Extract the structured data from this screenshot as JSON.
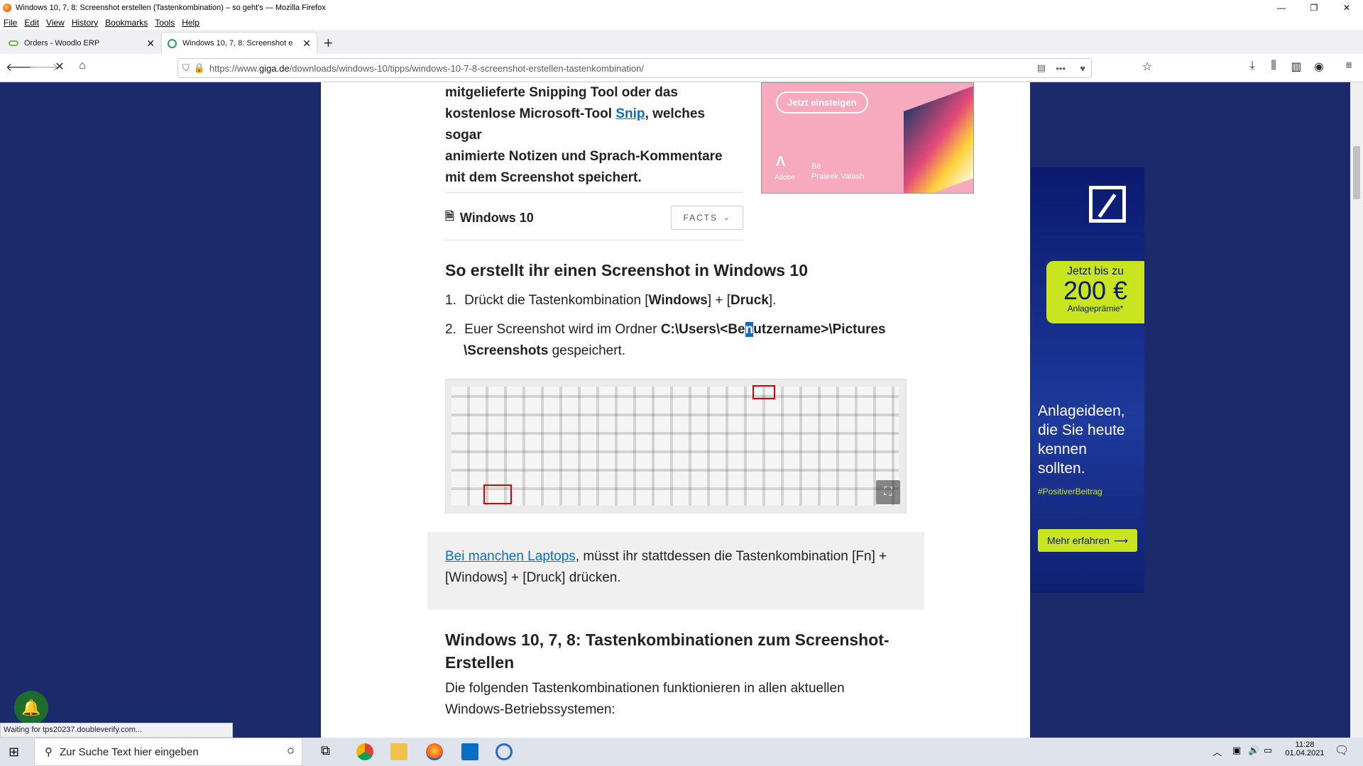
{
  "window": {
    "title": "Windows 10, 7, 8: Screenshot erstellen (Tastenkombination) – so geht's — Mozilla Firefox",
    "min": "—",
    "max": "❐",
    "close": "✕"
  },
  "menu": [
    "File",
    "Edit",
    "View",
    "History",
    "Bookmarks",
    "Tools",
    "Help"
  ],
  "tabs": [
    {
      "label": "Orders - Woodlo ERP",
      "active": false
    },
    {
      "label": "Windows 10, 7, 8: Screenshot e",
      "active": true
    }
  ],
  "newtab": "+",
  "url": {
    "prefix": "https://www.",
    "domain": "giga.de",
    "path": "/downloads/windows-10/tipps/windows-10-7-8-screenshot-erstellen-tastenkombination/"
  },
  "article": {
    "intro_l1": "mitgelieferte Snipping Tool oder das",
    "intro_l2_pre": "kostenlose Microsoft-Tool ",
    "intro_l2_link": "Snip",
    "intro_l2_post": ", welches sogar",
    "intro_l3": "animierte Notizen und Sprach-Kommentare",
    "intro_l4": "mit dem Screenshot speichert.",
    "facts_title": "Windows 10",
    "facts_button": "FACTS",
    "h2": "So erstellt ihr einen Screenshot in Windows 10",
    "step1_num": "1.",
    "step1_pre": "Drückt die Tastenkombination [",
    "step1_k1": "Windows",
    "step1_mid": "] + [",
    "step1_k2": "Druck",
    "step1_post": "].",
    "step2_num": "2.",
    "step2_pre": "Euer Screenshot wird im Ordner ",
    "step2_path1": "C:\\Users\\<Be",
    "step2_sel": "n",
    "step2_path2": "utzername>\\Pictures",
    "step2_path3": "\\Screenshots",
    "step2_post": " gespeichert.",
    "note_link": "Bei manchen Laptops",
    "note_l1": ", müsst ihr stattdessen die Tastenkombination [Fn] +",
    "note_l2": "[Windows] + [Druck] drücken.",
    "h2b_l1": "Windows 10, 7, 8: Tastenkombinationen zum Screenshot-",
    "h2b_l2": "Erstellen",
    "para_l1": "Die folgenden Tastenkombinationen funktionieren in allen aktuellen",
    "para_l2": "Windows-Betriebssystemen:"
  },
  "ad_adobe": {
    "button": "Jetzt einsteigen",
    "brand": "Adobe",
    "be": "Bē",
    "artist": "Prateek Vatash"
  },
  "ad_db": {
    "badge_l1": "Jetzt bis zu",
    "badge_amount": "200 €",
    "badge_l3": "Anlageprämie*",
    "headline_l1": "Anlageideen,",
    "headline_l2": "die Sie heute",
    "headline_l3": "kennen",
    "headline_l4": "sollten.",
    "hashtag": "#PositiverBeitrag",
    "cta": "Mehr erfahren"
  },
  "status": "Waiting for tps20237.doubleverify.com...",
  "taskbar": {
    "search_placeholder": "Zur Suche Text hier eingeben",
    "time": "11:28",
    "date": "01.04.2021"
  },
  "colors": {
    "page_bg": "#1b2a6b",
    "link": "#0a6ec4",
    "db_green": "#c9e51f",
    "adobe_pink": "#f7a9bd"
  }
}
